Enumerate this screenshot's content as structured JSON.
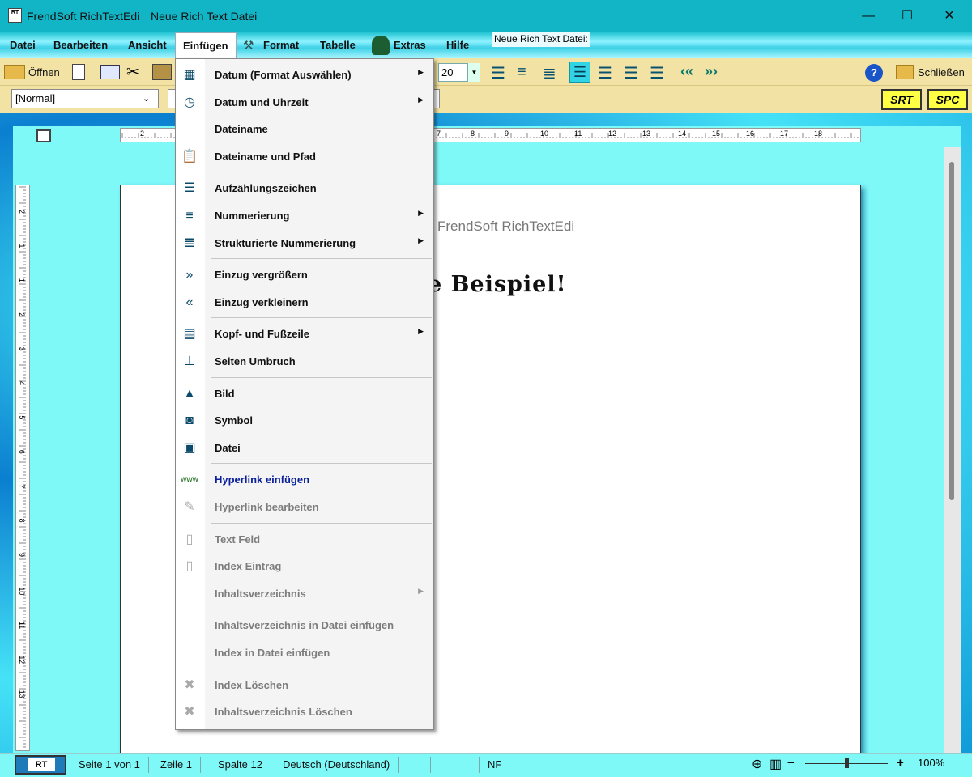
{
  "window": {
    "app_title": "FrendSoft RichTextEdi",
    "doc_title": "Neue Rich Text Datei",
    "app_icon": "RT",
    "minimize": "—",
    "maximize": "☐",
    "close": "✕"
  },
  "menubar": {
    "items": [
      "Datei",
      "Bearbeiten",
      "Ansicht",
      "Einfügen",
      "Format",
      "Tabelle",
      "Extras",
      "Hilfe"
    ],
    "doc_label": "Neue Rich Text Datei:"
  },
  "toolbar": {
    "open_label": "Öffnen",
    "font_size": "20",
    "close_label": "Schließen",
    "style_value": "[Normal]",
    "srt": "SRT",
    "spc": "SPC"
  },
  "page": {
    "header_text": "FrendSoft RichTextEdi",
    "heading_text": "e Beispiel!"
  },
  "ruler": {
    "h_ticks": [
      "2",
      "7",
      "8",
      "9",
      "10",
      "11",
      "12",
      "13",
      "14",
      "15",
      "16",
      "17",
      "18"
    ],
    "v_ticks": [
      "2",
      "1",
      "1",
      "2",
      "3",
      "4",
      "5",
      "6",
      "7",
      "8",
      "9",
      "10",
      "11",
      "12",
      "13"
    ]
  },
  "menu": {
    "items": [
      {
        "icon": "calendar-icon",
        "glyph": "▦",
        "label": "Datum (Format Auswählen)",
        "submenu": true,
        "enabled": true
      },
      {
        "icon": "clock-icon",
        "glyph": "◷",
        "label": "Datum und Uhrzeit",
        "submenu": true,
        "enabled": true
      },
      {
        "icon": "",
        "glyph": "",
        "label": "Dateiname",
        "submenu": false,
        "enabled": true
      },
      {
        "icon": "paste-file-icon",
        "glyph": "📋",
        "label": "Dateiname und Pfad",
        "submenu": false,
        "enabled": true
      },
      {
        "icon": "bullet-list-icon",
        "glyph": "☰",
        "label": "Aufzählungszeichen",
        "submenu": false,
        "enabled": true
      },
      {
        "icon": "numbered-list-icon",
        "glyph": "≡",
        "label": "Nummerierung",
        "submenu": true,
        "enabled": true
      },
      {
        "icon": "outline-numbering-icon",
        "glyph": "≣",
        "label": "Strukturierte Nummerierung",
        "submenu": true,
        "enabled": true
      },
      {
        "icon": "indent-increase-icon",
        "glyph": "»",
        "label": "Einzug vergrößern",
        "submenu": false,
        "enabled": true
      },
      {
        "icon": "indent-decrease-icon",
        "glyph": "«",
        "label": "Einzug verkleinern",
        "submenu": false,
        "enabled": true
      },
      {
        "icon": "header-footer-icon",
        "glyph": "▤",
        "label": "Kopf- und Fußzeile",
        "submenu": true,
        "enabled": true
      },
      {
        "icon": "page-break-icon",
        "glyph": "⊥",
        "label": "Seiten Umbruch",
        "submenu": false,
        "enabled": true
      },
      {
        "icon": "picture-icon",
        "glyph": "▲",
        "label": "Bild",
        "submenu": false,
        "enabled": true
      },
      {
        "icon": "symbol-icon",
        "glyph": "◙",
        "label": "Symbol",
        "submenu": false,
        "enabled": true
      },
      {
        "icon": "file-icon",
        "glyph": "▣",
        "label": "Datei",
        "submenu": false,
        "enabled": true
      },
      {
        "icon": "www-icon",
        "glyph": "www",
        "label": "Hyperlink einfügen",
        "submenu": false,
        "enabled": true
      },
      {
        "icon": "edit-link-icon",
        "glyph": "✎",
        "label": "Hyperlink bearbeiten",
        "submenu": false,
        "enabled": false
      },
      {
        "icon": "text-field-icon",
        "glyph": "▯",
        "label": "Text Feld",
        "submenu": false,
        "enabled": false
      },
      {
        "icon": "index-entry-icon",
        "glyph": "▯",
        "label": "Index Eintrag",
        "submenu": false,
        "enabled": false
      },
      {
        "icon": "",
        "glyph": "",
        "label": "Inhaltsverzeichnis",
        "submenu": true,
        "enabled": false
      },
      {
        "icon": "",
        "glyph": "",
        "label": "Inhaltsverzeichnis in Datei einfügen",
        "submenu": false,
        "enabled": false
      },
      {
        "icon": "",
        "glyph": "",
        "label": "Index in Datei einfügen",
        "submenu": false,
        "enabled": false
      },
      {
        "icon": "delete-index-icon",
        "glyph": "✖",
        "label": "Index Löschen",
        "submenu": false,
        "enabled": false
      },
      {
        "icon": "delete-toc-icon",
        "glyph": "✖",
        "label": "Inhaltsverzeichnis Löschen",
        "submenu": false,
        "enabled": false
      }
    ]
  },
  "status": {
    "logo": "RT",
    "page": "Seite 1 von 1",
    "line": "Zeile 1",
    "column": "Spalte 12",
    "language": "Deutsch (Deutschland)",
    "nf": "NF",
    "zoom_minus": "−",
    "zoom_plus": "+",
    "zoom": "100%",
    "zoom_level": 50
  }
}
